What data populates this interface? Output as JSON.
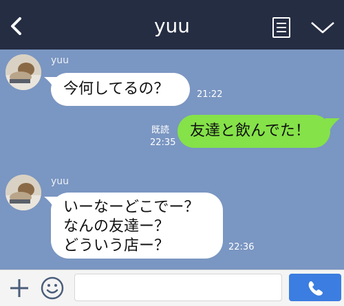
{
  "header": {
    "title": "yuu",
    "icons": [
      "back-chevron-icon",
      "note-icon",
      "chevron-down-icon"
    ]
  },
  "messages": [
    {
      "sender": "yuu",
      "direction": "in",
      "text": "今何してるの？",
      "time": "21:22"
    },
    {
      "sender": "me",
      "direction": "out",
      "text": "友達と飲んでた！",
      "read": "既読",
      "time": "22:35"
    },
    {
      "sender": "yuu",
      "direction": "in",
      "lines": [
        "いーなーどこでー？",
        "なんの友達ー？",
        "どういう店ー？"
      ],
      "time": "22:36"
    }
  ],
  "footer": {
    "input_value": "",
    "icons": [
      "plus-icon",
      "smile-icon",
      "phone-icon"
    ]
  },
  "colors": {
    "header_bg": "#252d43",
    "chat_bg": "#7a96c2",
    "incoming_bubble": "#ffffff",
    "outgoing_bubble": "#85e249",
    "call_button": "#3b7de0"
  }
}
